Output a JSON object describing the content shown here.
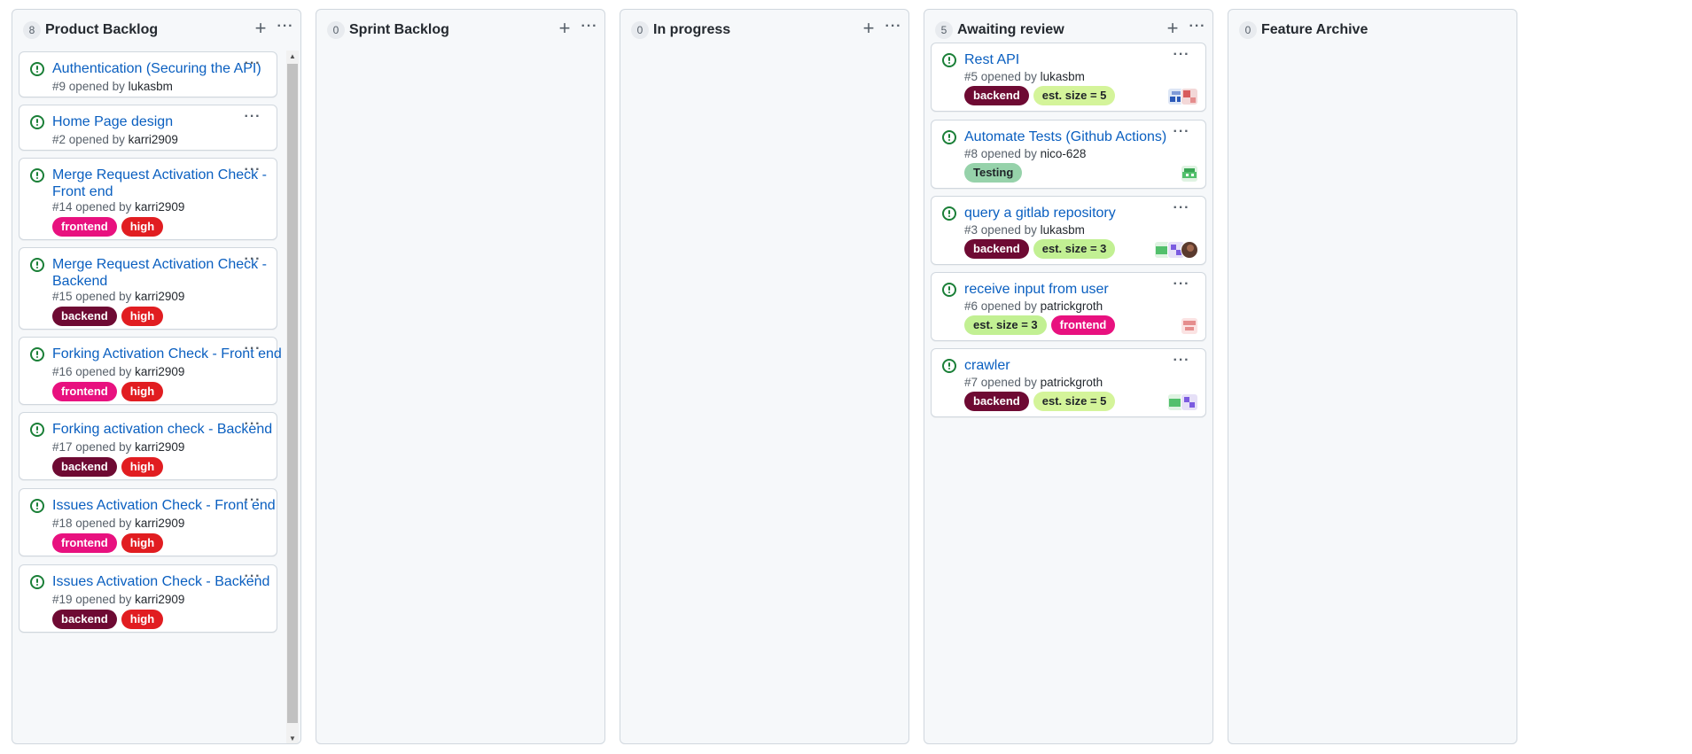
{
  "columns": {
    "product_backlog": {
      "count": "8",
      "title": "Product Backlog",
      "cards": [
        {
          "title": "Authentication (Securing the API)",
          "number": "#9",
          "opened_by": "opened by",
          "author": "lukasbm"
        },
        {
          "title": "Home Page design",
          "number": "#2",
          "opened_by": "opened by",
          "author": "karri2909"
        },
        {
          "title": "Merge Request Activation Check - Front end",
          "number": "#14",
          "opened_by": "opened by",
          "author": "karri2909",
          "labels": [
            "frontend",
            "high"
          ]
        },
        {
          "title": "Merge Request Activation Check - Backend",
          "number": "#15",
          "opened_by": "opened by",
          "author": "karri2909",
          "labels": [
            "backend",
            "high"
          ]
        },
        {
          "title": "Forking Activation Check - Front end",
          "number": "#16",
          "opened_by": "opened by",
          "author": "karri2909",
          "labels": [
            "frontend",
            "high"
          ]
        },
        {
          "title": "Forking activation check - Backend",
          "number": "#17",
          "opened_by": "opened by",
          "author": "karri2909",
          "labels": [
            "backend",
            "high"
          ]
        },
        {
          "title": "Issues Activation Check - Front end",
          "number": "#18",
          "opened_by": "opened by",
          "author": "karri2909",
          "labels": [
            "frontend",
            "high"
          ]
        },
        {
          "title": "Issues Activation Check - Backend",
          "number": "#19",
          "opened_by": "opened by",
          "author": "karri2909",
          "labels": [
            "backend",
            "high"
          ]
        }
      ]
    },
    "sprint_backlog": {
      "count": "0",
      "title": "Sprint Backlog"
    },
    "in_progress": {
      "count": "0",
      "title": "In progress"
    },
    "awaiting_review": {
      "count": "5",
      "title": "Awaiting review",
      "cards": [
        {
          "title": "Rest API",
          "number": "#5",
          "opened_by": "opened by",
          "author": "lukasbm",
          "labels": [
            "backend",
            "est. size = 5"
          ]
        },
        {
          "title": "Automate Tests (Github Actions)",
          "number": "#8",
          "opened_by": "opened by",
          "author": "nico-628",
          "labels": [
            "Testing"
          ]
        },
        {
          "title": "query a gitlab repository",
          "number": "#3",
          "opened_by": "opened by",
          "author": "lukasbm",
          "labels": [
            "backend",
            "est. size = 3"
          ]
        },
        {
          "title": "receive input from user",
          "number": "#6",
          "opened_by": "opened by",
          "author": "patrickgroth",
          "labels": [
            "est. size = 3",
            "frontend"
          ]
        },
        {
          "title": "crawler",
          "number": "#7",
          "opened_by": "opened by",
          "author": "patrickgroth",
          "labels": [
            "backend",
            "est. size = 5"
          ]
        }
      ]
    },
    "feature_archive": {
      "count": "0",
      "title": "Feature Archive"
    }
  },
  "icons": {
    "add": "+",
    "more": "···",
    "scroll_up": "▲",
    "scroll_down": "▼"
  },
  "label_colors": {
    "frontend": {
      "bg": "#e8117f",
      "fg": "#ffffff"
    },
    "high": {
      "bg": "#e11d21",
      "fg": "#ffffff"
    },
    "backend": {
      "bg": "#6e0a33",
      "fg": "#ffffff"
    },
    "est. size = 5": {
      "bg": "#d4f49a",
      "fg": "#1f2328"
    },
    "est. size = 3": {
      "bg": "#c2f093",
      "fg": "#1f2328"
    },
    "Testing": {
      "bg": "#96d2aa",
      "fg": "#1f2328"
    }
  },
  "colors": {
    "link": "#0a5fc0",
    "open_issue": "#1a7f37",
    "column_bg": "#f6f8fa"
  }
}
